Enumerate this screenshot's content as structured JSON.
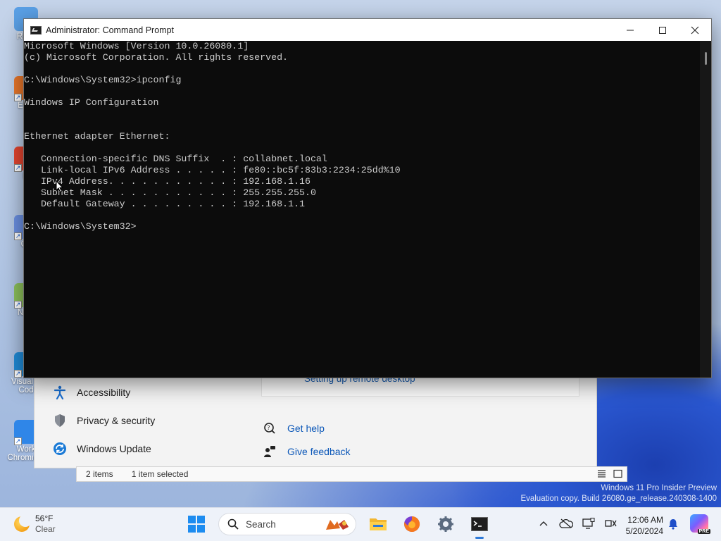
{
  "desktop": {
    "icons": [
      {
        "name": "Recycle Bin",
        "label": "Recy",
        "color": "#5aa0e6"
      },
      {
        "name": "Everything",
        "label": "Ever",
        "color": "#e8762a"
      },
      {
        "name": "Firefox",
        "label": "Fi",
        "color": "#e2442f"
      },
      {
        "name": "GitHub",
        "label": "Git",
        "color": "#6a8fe0"
      },
      {
        "name": "Notepad++",
        "label": "Note",
        "color": "#8bbf5a"
      },
      {
        "name": "Visual Studio Code",
        "label": "Visual S Cod",
        "color": "#1f8ad6"
      },
      {
        "name": "Work Chromium",
        "label": "Work Chromium",
        "color": "#2f86e8"
      }
    ],
    "watermark": {
      "line1": "Windows 11 Pro Insider Preview",
      "line2": "Evaluation copy. Build 26080.ge_release.240308-1400"
    }
  },
  "settings": {
    "sidebar": [
      {
        "label": "Accessibility",
        "icon": "accessibility-icon"
      },
      {
        "label": "Privacy & security",
        "icon": "shield-icon"
      },
      {
        "label": "Windows Update",
        "icon": "windows-update-icon"
      }
    ],
    "card_link": "Setting up remote desktop",
    "help": [
      {
        "label": "Get help",
        "icon": "get-help-icon"
      },
      {
        "label": "Give feedback",
        "icon": "feedback-icon"
      }
    ]
  },
  "explorer_status": {
    "items": "2 items",
    "selected": "1 item selected"
  },
  "cmd": {
    "title": "Administrator: Command Prompt",
    "lines": [
      "Microsoft Windows [Version 10.0.26080.1]",
      "(c) Microsoft Corporation. All rights reserved.",
      "",
      "C:\\Windows\\System32>ipconfig",
      "",
      "Windows IP Configuration",
      "",
      "",
      "Ethernet adapter Ethernet:",
      "",
      "   Connection-specific DNS Suffix  . : collabnet.local",
      "   Link-local IPv6 Address . . . . . : fe80::bc5f:83b3:2234:25dd%10",
      "   IPv4 Address. . . . . . . . . . . : 192.168.1.16",
      "   Subnet Mask . . . . . . . . . . . : 255.255.255.0",
      "   Default Gateway . . . . . . . . . : 192.168.1.1",
      "",
      "C:\\Windows\\System32>"
    ]
  },
  "taskbar": {
    "weather": {
      "temp": "56°F",
      "condition": "Clear"
    },
    "search_placeholder": "Search",
    "apps": [
      {
        "name": "file-explorer",
        "color": "#f2b630"
      },
      {
        "name": "firefox",
        "color": "#e8542a"
      },
      {
        "name": "settings",
        "color": "#5b6b80"
      },
      {
        "name": "command-prompt",
        "color": "#1e1e1e"
      }
    ],
    "time": "12:06 AM",
    "date": "5/20/2024",
    "copilot_badge": "PRE"
  }
}
